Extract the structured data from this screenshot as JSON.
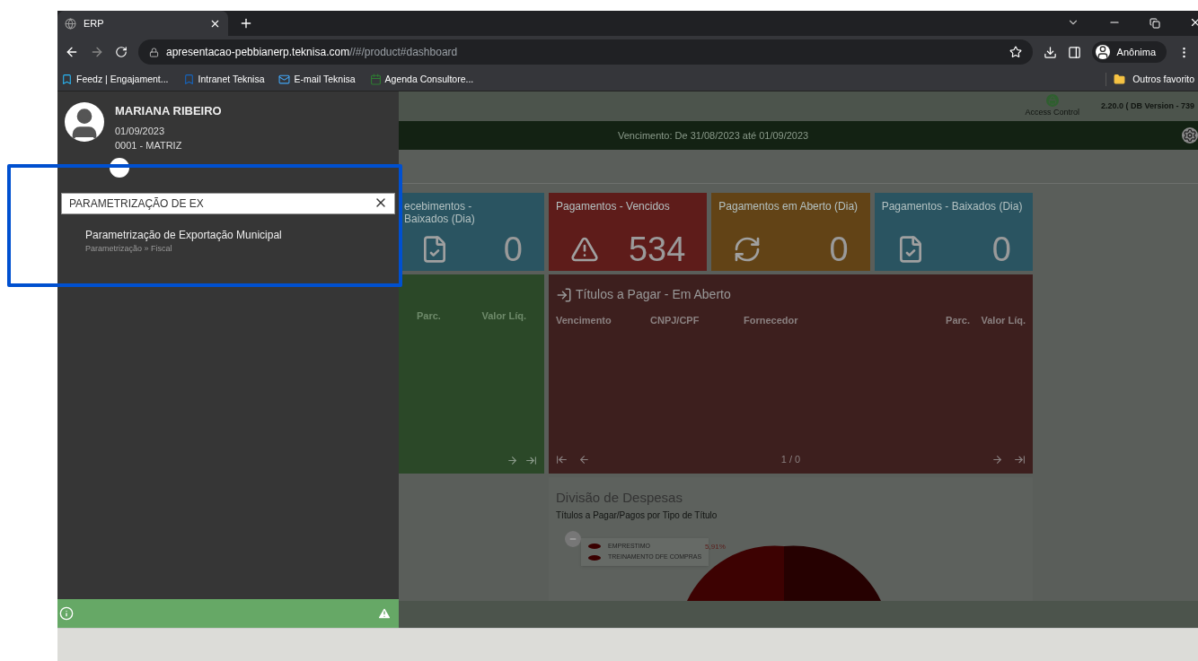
{
  "browser": {
    "tab_title": "ERP",
    "url_host": "apresentacao-pebbianerp.teknisa.com",
    "url_path": "//#/product#dashboard",
    "profile": "Anônima",
    "bookmarks": [
      {
        "label": "Feedz | Engajament...",
        "kind": "feedz"
      },
      {
        "label": "Intranet Teknisa",
        "kind": "intranet"
      },
      {
        "label": "E-mail Teknisa",
        "kind": "mail"
      },
      {
        "label": "Agenda Consultore...",
        "kind": "agenda"
      }
    ],
    "other_bookmarks": "Outros favorito"
  },
  "sidebar": {
    "user": {
      "name": "MARIANA RIBEIRO",
      "date": "01/09/2023",
      "unit": "0001 - MATRIZ"
    },
    "search": {
      "value": "PARAMETRIZAÇÃO DE EX"
    },
    "results": [
      {
        "title": "Parametrização de Exportação Municipal",
        "path": "Parametrização » Fiscal"
      }
    ]
  },
  "header": {
    "access_control": "Access Control",
    "version": "2.20.0 ( DB Version - 739",
    "period": "Vencimento: De 31/08/2023 até 01/09/2023"
  },
  "cards": [
    {
      "title": "ecebimentos - Baixados (Dia)",
      "value": "0",
      "kind": "settled"
    },
    {
      "title": "Pagamentos - Vencidos",
      "value": "534",
      "kind": "overdue"
    },
    {
      "title": "Pagamentos em Aberto (Dia)",
      "value": "0",
      "kind": "open"
    },
    {
      "title": "Pagamentos - Baixados (Dia)",
      "value": "0",
      "kind": "settled"
    }
  ],
  "receivables_panel": {
    "columns": [
      "Parc.",
      "Valor Líq."
    ]
  },
  "payables_panel": {
    "title": "Títulos a Pagar - Em Aberto",
    "columns": [
      "Vencimento",
      "CNPJ/CPF",
      "Fornecedor",
      "Parc.",
      "Valor Líq."
    ],
    "page": "1 / 0"
  },
  "expenses": {
    "title": "Divisão de Despesas",
    "subtitle": "Títulos a Pagar/Pagos por Tipo de Título",
    "legend": [
      "EMPRESTIMO",
      "TREINAMENTO DFE COMPRAS"
    ],
    "slice_label": "5,91%"
  }
}
